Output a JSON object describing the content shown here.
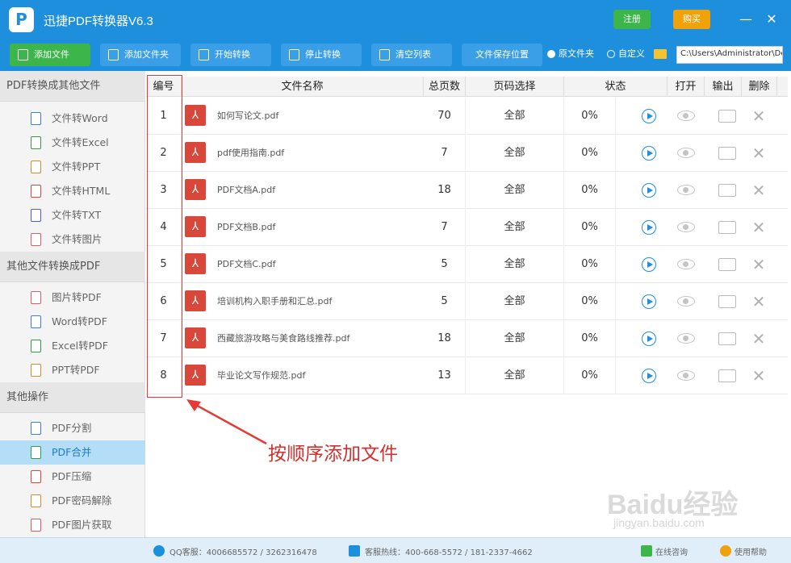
{
  "app": {
    "title": "迅捷PDF转换器V6.3",
    "logo_letter": "P",
    "register_label": "注册",
    "buy_label": "购买"
  },
  "toolbar": {
    "add_file": "添加文件",
    "add_folder": "添加文件夹",
    "start": "开始转换",
    "stop": "停止转换",
    "clear": "清空列表",
    "output_label": "文件保存位置",
    "radio_original": "原文件夹",
    "radio_custom": "自定义",
    "output_path": "C:\\Users\\Administrator\\Desktop"
  },
  "sidebar": {
    "section1": "PDF转换成其他文件",
    "section1_items": [
      "文件转Word",
      "文件转Excel",
      "文件转PPT",
      "文件转HTML",
      "文件转TXT",
      "文件转图片"
    ],
    "section2": "其他文件转换成PDF",
    "section2_items": [
      "图片转PDF",
      "Word转PDF",
      "Excel转PDF",
      "PPT转PDF"
    ],
    "section3": "其他操作",
    "section3_items": [
      "PDF分割",
      "PDF合并",
      "PDF压缩",
      "PDF密码解除",
      "PDF图片获取"
    ]
  },
  "table": {
    "headers": {
      "index": "编号",
      "name": "文件名称",
      "pages": "总页数",
      "page_select": "页码选择",
      "status": "状态",
      "open": "打开",
      "output": "输出",
      "delete": "删除"
    },
    "rows": [
      {
        "index": "1",
        "name": "如何写论文.pdf",
        "pages": "70",
        "page_select": "全部",
        "status": "0%"
      },
      {
        "index": "2",
        "name": "pdf使用指南.pdf",
        "pages": "7",
        "page_select": "全部",
        "status": "0%"
      },
      {
        "index": "3",
        "name": "PDF文档A.pdf",
        "pages": "18",
        "page_select": "全部",
        "status": "0%"
      },
      {
        "index": "4",
        "name": "PDF文档B.pdf",
        "pages": "7",
        "page_select": "全部",
        "status": "0%"
      },
      {
        "index": "5",
        "name": "PDF文档C.pdf",
        "pages": "5",
        "page_select": "全部",
        "status": "0%"
      },
      {
        "index": "6",
        "name": "培训机构入职手册和汇总.pdf",
        "pages": "5",
        "page_select": "全部",
        "status": "0%"
      },
      {
        "index": "7",
        "name": "西藏旅游攻略与美食路线推荐.pdf",
        "pages": "18",
        "page_select": "全部",
        "status": "0%"
      },
      {
        "index": "8",
        "name": "毕业论文写作规范.pdf",
        "pages": "13",
        "page_select": "全部",
        "status": "0%"
      }
    ]
  },
  "annotation": {
    "text": "按顺序添加文件"
  },
  "statusbar": {
    "qq": "QQ客服：4006685572 / 3262316478",
    "phone": "客服热线：400-668-5572 / 181-2337-4662",
    "online": "在线咨询",
    "help": "使用帮助"
  },
  "watermark": {
    "main": "Baidu经验",
    "sub": "jingyan.baidu.com"
  },
  "colors": {
    "brand": "#1e8fdc",
    "green": "#3cb64a",
    "orange": "#f0a20b",
    "pdf_red": "#d9473a",
    "annotation_red": "#d32f2f"
  }
}
